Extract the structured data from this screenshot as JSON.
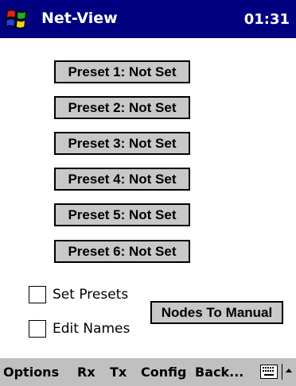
{
  "titlebar": {
    "app_title": "Net-View",
    "clock": "01:31",
    "start_icon": "windows-flag-icon"
  },
  "presets": [
    {
      "label": "Preset 1: Not Set"
    },
    {
      "label": "Preset 2: Not Set"
    },
    {
      "label": "Preset 3: Not Set"
    },
    {
      "label": "Preset 4: Not Set"
    },
    {
      "label": "Preset 5: Not Set"
    },
    {
      "label": "Preset 6: Not Set"
    }
  ],
  "options": {
    "set_presets": {
      "label": "Set Presets",
      "checked": false
    },
    "edit_names": {
      "label": "Edit Names",
      "checked": false
    }
  },
  "nodes_button": {
    "label": "Nodes To Manual"
  },
  "menubar": {
    "items": [
      "Options",
      "Rx",
      "Tx",
      "Config",
      "Back..."
    ],
    "keyboard_icon": "keyboard-icon",
    "sip_arrow_icon": "up-arrow-icon"
  },
  "colors": {
    "titlebar_bg": "#000080",
    "button_bg": "#c8c8c8",
    "menubar_bg": "#c0c0c0"
  }
}
